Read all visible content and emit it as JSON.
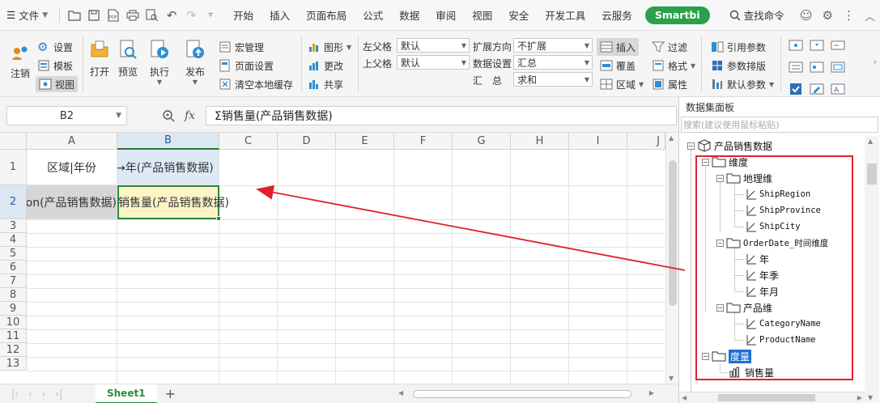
{
  "menu": {
    "file_label": "文件",
    "tabs": [
      "开始",
      "插入",
      "页面布局",
      "公式",
      "数据",
      "审阅",
      "视图",
      "安全",
      "开发工具",
      "云服务"
    ],
    "smartbi": "Smartbi",
    "search_cmd": "查找命令"
  },
  "ribbon": {
    "logout": "注销",
    "settings": "设置",
    "template": "模板",
    "view": "视图",
    "open": "打开",
    "preview": "预览",
    "execute": "执行",
    "publish": "发布",
    "macro": "宏管理",
    "page_setup": "页面设置",
    "clear_cache": "清空本地缓存",
    "shape": "图形",
    "change": "更改",
    "share": "共享",
    "left_parent_label": "左父格",
    "left_parent_value": "默认",
    "top_parent_label": "上父格",
    "top_parent_value": "默认",
    "expand_dir_label": "扩展方向",
    "expand_dir_value": "不扩展",
    "data_setting_label": "数据设置",
    "data_setting_value": "汇总",
    "summary_label": "汇　总",
    "summary_value": "求和",
    "insert": "插入",
    "overwrite": "覆盖",
    "region": "区域",
    "filter": "过滤",
    "format": "格式",
    "property": "属性",
    "ref_param": "引用参数",
    "param_layout": "参数排版",
    "default_param": "默认参数"
  },
  "formula_bar": {
    "cell_ref": "B2",
    "fx": "fx",
    "formula": "Σ销售量(产品销售数据)"
  },
  "grid": {
    "columns": [
      "A",
      "B",
      "C",
      "D",
      "E",
      "F",
      "G",
      "H",
      "I",
      "J"
    ],
    "rows": [
      "1",
      "2",
      "3",
      "4",
      "5",
      "6",
      "7",
      "8",
      "9",
      "10",
      "11",
      "12",
      "13"
    ],
    "a1": "区域|年份",
    "b1": "→年(产品销售数据)",
    "a2": "↓ShipRegion(产品销售数据)",
    "b2": "销售量(产品销售数据)"
  },
  "sheets": {
    "active": "Sheet1",
    "add": "+"
  },
  "panel": {
    "title": "数据集面板",
    "search_placeholder": "搜索(建议使用鼠标粘贴)",
    "root": "产品销售数据",
    "dimension": "维度",
    "geo_dim": "地理维",
    "ship_region": "ShipRegion",
    "ship_province": "ShipProvince",
    "ship_city": "ShipCity",
    "orderdate_dim": "OrderDate_时间维度",
    "year": "年",
    "year_quarter": "年季",
    "year_month": "年月",
    "product_dim": "产品维",
    "category_name": "CategoryName",
    "product_name": "ProductName",
    "measure": "度量",
    "sales_qty": "销售量"
  }
}
